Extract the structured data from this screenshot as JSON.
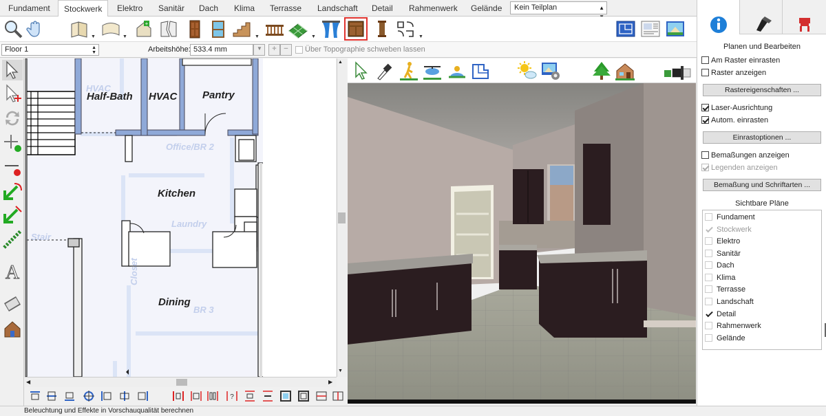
{
  "tabs": [
    "Fundament",
    "Stockwerk",
    "Elektro",
    "Sanitär",
    "Dach",
    "Klima",
    "Terrasse",
    "Landschaft",
    "Detail",
    "Rahmenwerk",
    "Gelände"
  ],
  "active_tab": "Stockwerk",
  "teilplan": {
    "value": "Kein Teilplan"
  },
  "floor_select": {
    "value": "Floor 1"
  },
  "arbeitshoehe": {
    "label": "Arbeitshöhe:",
    "value": "533.4 mm"
  },
  "topo_checkbox": {
    "label": "Über Topographie schweben lassen",
    "checked": false
  },
  "plan": {
    "rooms": [
      "Half-Bath",
      "HVAC",
      "Pantry",
      "Kitchen",
      "Dining"
    ],
    "ghost_labels": [
      "Office/BR 2",
      "Laundry",
      "Closet",
      "BR 3",
      "HVAC",
      "Stair"
    ]
  },
  "status": "Beleuchtung und Effekte in Vorschauqualität berechnen",
  "panel": {
    "section_title": "Planen und Bearbeiten",
    "checkboxes": [
      {
        "label": "Am Raster einrasten",
        "checked": false,
        "enabled": true
      },
      {
        "label": "Raster anzeigen",
        "checked": false,
        "enabled": true
      }
    ],
    "button_raster": "Rastereigenschaften ...",
    "checkboxes2": [
      {
        "label": "Laser-Ausrichtung",
        "checked": true,
        "enabled": true
      },
      {
        "label": "Autom. einrasten",
        "checked": true,
        "enabled": true
      }
    ],
    "button_snap": "Einrastoptionen ...",
    "checkboxes3": [
      {
        "label": "Bemaßungen anzeigen",
        "checked": false,
        "enabled": true
      },
      {
        "label": "Legenden anzeigen",
        "checked": true,
        "enabled": false
      }
    ],
    "button_dims": "Bemaßung und Schriftarten ...",
    "visible_plans_title": "Sichtbare Pläne",
    "visible_plans": [
      {
        "label": "Fundament",
        "checked": false,
        "enabled": true
      },
      {
        "label": "Stockwerk",
        "checked": true,
        "enabled": false
      },
      {
        "label": "Elektro",
        "checked": false,
        "enabled": true
      },
      {
        "label": "Sanitär",
        "checked": false,
        "enabled": true
      },
      {
        "label": "Dach",
        "checked": false,
        "enabled": true
      },
      {
        "label": "Klima",
        "checked": false,
        "enabled": true
      },
      {
        "label": "Terrasse",
        "checked": false,
        "enabled": true
      },
      {
        "label": "Landschaft",
        "checked": false,
        "enabled": true
      },
      {
        "label": "Detail",
        "checked": true,
        "enabled": true
      },
      {
        "label": "Rahmenwerk",
        "checked": false,
        "enabled": true
      },
      {
        "label": "Gelände",
        "checked": false,
        "enabled": true
      }
    ]
  },
  "colors": {
    "accent_blue": "#1e7fd8",
    "selected_outline": "#e0332e",
    "wall_blue": "#8fa9d8"
  }
}
